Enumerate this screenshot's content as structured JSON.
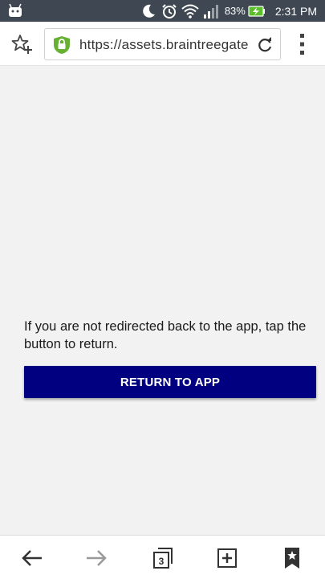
{
  "status_bar": {
    "battery_percent": "83%",
    "time": "2:31 PM",
    "icons": [
      "android-icon",
      "moon-icon",
      "alarm-icon",
      "wifi-icon",
      "signal-icon",
      "battery-charging-icon"
    ]
  },
  "toolbar": {
    "url": "https://assets.braintreegateway.com",
    "icons": [
      "bookmark-star-icon",
      "lock-icon",
      "reload-icon",
      "more-menu-icon"
    ]
  },
  "content": {
    "message": "If you are not redirected back to the app, tap the button to return.",
    "button_label": "RETURN TO APP"
  },
  "bottom_nav": {
    "tab_count": "3",
    "icons": [
      "back-arrow-icon",
      "forward-arrow-icon",
      "tabs-icon",
      "new-tab-icon",
      "bookmarks-icon"
    ]
  },
  "colors": {
    "status_bar_bg": "#3f4852",
    "button_bg": "#000080",
    "lock_green": "#66b032",
    "page_bg": "#f2f2f2"
  }
}
